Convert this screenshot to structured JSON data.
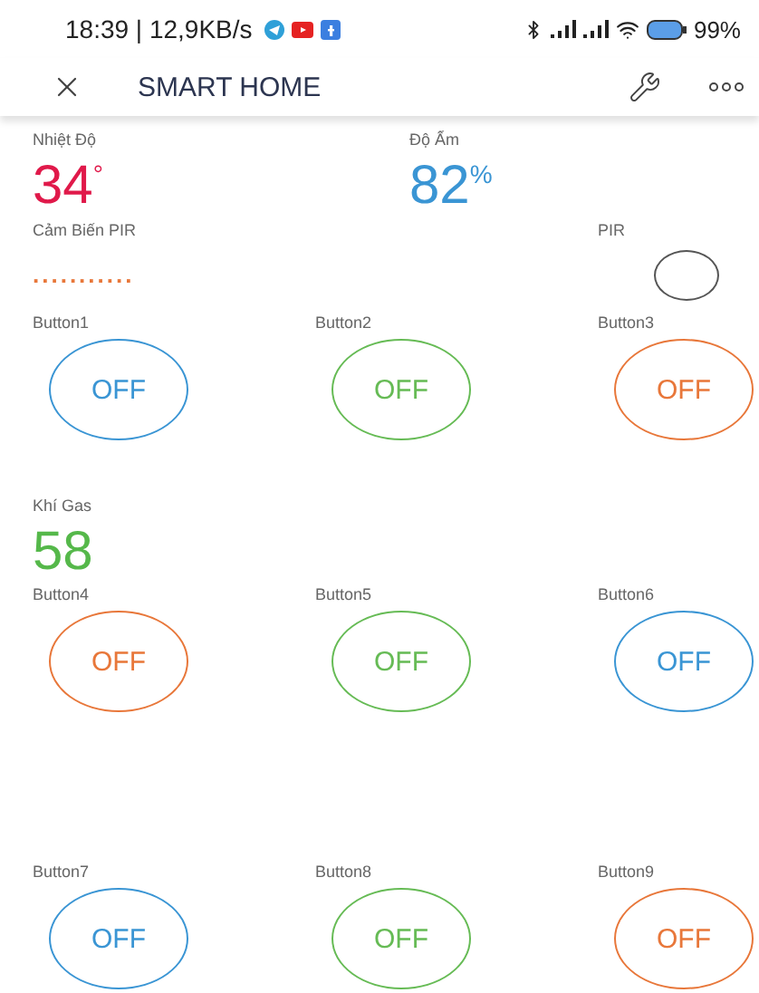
{
  "status_bar": {
    "time": "18:39 | 12,9KB/s",
    "battery": "99%"
  },
  "app_bar": {
    "title": "SMART HOME"
  },
  "temperature": {
    "label": "Nhiệt Độ",
    "value": "34",
    "unit": "°"
  },
  "humidity": {
    "label": "Độ Ẩm",
    "value": "82",
    "unit": "%"
  },
  "pir_sensor": {
    "label": "Cảm Biến PIR",
    "value": "..........."
  },
  "pir_led": {
    "label": "PIR",
    "on": false
  },
  "buttons_top": [
    {
      "label": "Button1",
      "text": "OFF",
      "color": "#3a95d4",
      "on": false
    },
    {
      "label": "Button2",
      "text": "OFF",
      "color": "#66bb55",
      "on": false
    },
    {
      "label": "Button3",
      "text": "OFF",
      "color": "#e8773a",
      "on": false
    }
  ],
  "gas": {
    "label": "Khí Gas",
    "value": "58"
  },
  "buttons_middle": [
    {
      "label": "Button4",
      "text": "OFF",
      "color": "#e8773a",
      "on": false
    },
    {
      "label": "Button5",
      "text": "OFF",
      "color": "#66bb55",
      "on": false
    },
    {
      "label": "Button6",
      "text": "OFF",
      "color": "#3a95d4",
      "on": false
    }
  ],
  "buttons_bottom": [
    {
      "label": "Button7",
      "text": "OFF",
      "color": "#3a95d4",
      "on": false
    },
    {
      "label": "Button8",
      "text": "OFF",
      "color": "#66bb55",
      "on": false
    },
    {
      "label": "Button9",
      "text": "OFF",
      "color": "#e8773a",
      "on": false
    }
  ]
}
